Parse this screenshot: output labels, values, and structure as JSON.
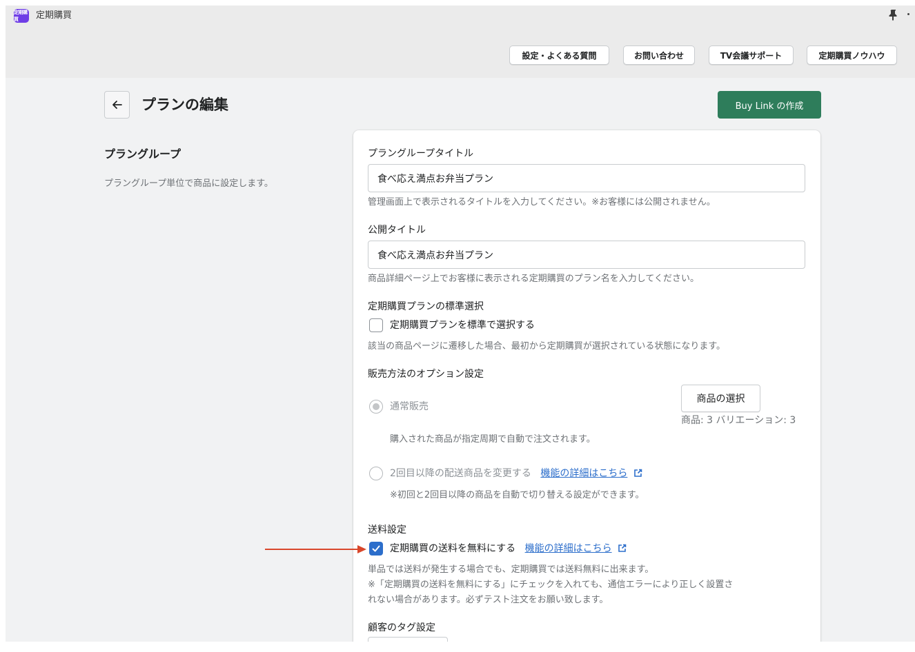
{
  "app": {
    "logo_text": "定期購買",
    "title": "定期購買",
    "pin_icon": "pin-icon",
    "more_icon": "more-icon"
  },
  "header_links": [
    {
      "label": "設定・よくある質問"
    },
    {
      "label": "お問い合わせ"
    },
    {
      "label": "TV会議サポート"
    },
    {
      "label": "定期購買ノウハウ"
    }
  ],
  "page": {
    "back_icon": "arrow-left-icon",
    "title": "プランの編集",
    "primary_action": "Buy Link の作成"
  },
  "section": {
    "title": "プラングループ",
    "description": "プラングループ単位で商品に設定します。"
  },
  "form": {
    "group_title": {
      "label": "プラングループタイトル",
      "value": "食べ応え満点お弁当プラン",
      "help": "管理画面上で表示されるタイトルを入力してください。※お客様には公開されません。"
    },
    "public_title": {
      "label": "公開タイトル",
      "value": "食べ応え満点お弁当プラン",
      "help": "商品詳細ページ上でお客様に表示される定期購買のプラン名を入力してください。"
    },
    "default_select": {
      "label": "定期購買プランの標準選択",
      "checkbox_label": "定期購買プランを標準で選択する",
      "checked": false,
      "help": "該当の商品ページに遷移した場合、最初から定期購買が選択されている状態になります。"
    },
    "sales_option": {
      "label": "販売方法のオプション設定",
      "normal": {
        "label": "通常販売",
        "selected": true,
        "help": "購入された商品が指定周期で自動で注文されます。"
      },
      "product_button": "商品の選択",
      "product_count": "商品: 3 バリエーション: 3",
      "change": {
        "label": "2回目以降の配送商品を変更する",
        "link": "機能の詳細はこちら",
        "selected": false,
        "help": "※初回と2回目以降の商品を自動で切り替える設定ができます。"
      }
    },
    "shipping": {
      "label": "送料設定",
      "checkbox_label": "定期購買の送料を無料にする",
      "link": "機能の詳細はこちら",
      "checked": true,
      "help_1": "単品では送料が発生する場合でも、定期購買では送料無料に出来ます。",
      "help_2": "※「定期購買の送料を無料にする」にチェックを入れても、通信エラーにより正しく設置さ",
      "help_3": "れない場合があります。必ずテスト注文をお願い致します。"
    },
    "customer_tag": {
      "label": "顧客のタグ設定"
    }
  },
  "colors": {
    "primary": "#2e7d5b",
    "link": "#2c6ecb",
    "checkbox": "#2c6ecb",
    "annotation_arrow": "#d9472b",
    "app_logo": "#6f3ee6"
  }
}
